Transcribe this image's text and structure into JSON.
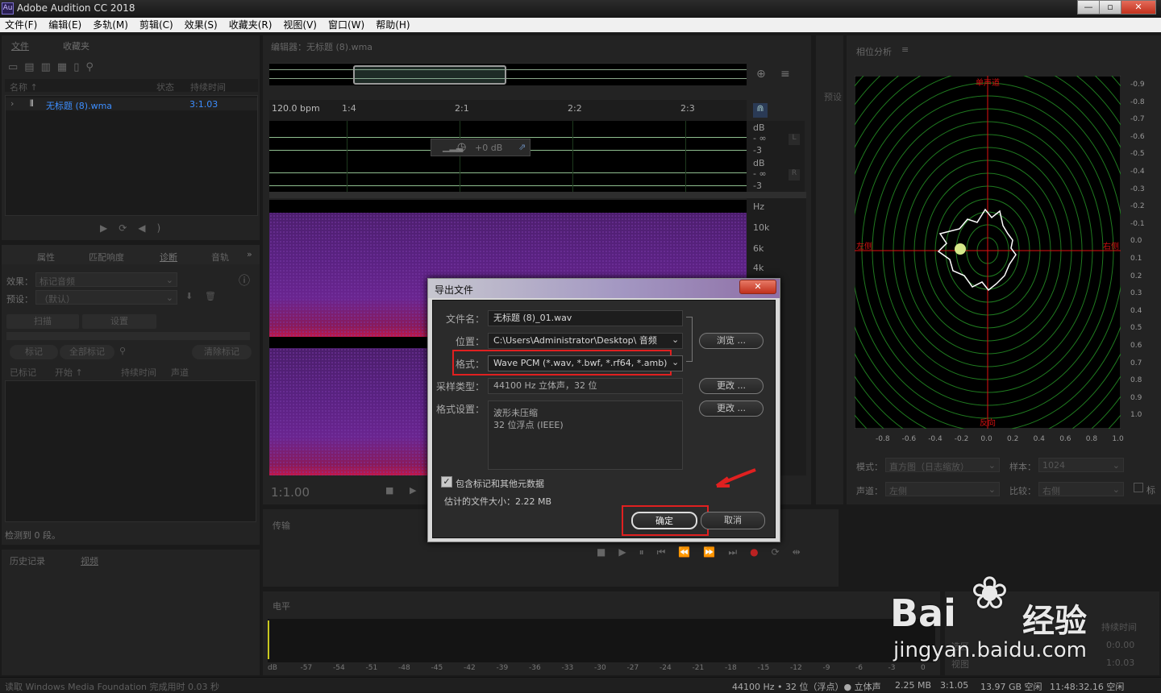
{
  "app": {
    "title": "Adobe Audition CC 2018",
    "logo": "Au",
    "win_buttons": [
      "—",
      "▫",
      "✕"
    ]
  },
  "menu": [
    "文件(F)",
    "编辑(E)",
    "多轨(M)",
    "剪辑(C)",
    "效果(S)",
    "收藏夹(R)",
    "视图(V)",
    "窗口(W)",
    "帮助(H)"
  ],
  "files_panel": {
    "tabs": [
      "文件",
      "收藏夹"
    ],
    "cols": [
      "名称 ↑",
      "状态",
      "持续时间"
    ],
    "file": {
      "name": "无标题 (8).wma",
      "duration": "3:1.03"
    }
  },
  "props_panel": {
    "tabs": [
      "属性",
      "匹配响度",
      "诊断",
      "音轨"
    ],
    "effect_label": "效果：",
    "effect_value": "标记音频",
    "preset_label": "预设：",
    "preset_value": "（默认）",
    "scan": "扫描",
    "settings": "设置",
    "mark": "标记",
    "mark_all": "全部标记",
    "clear_marks": "清除标记",
    "cols": [
      "已标记",
      "开始 ↑",
      "持续时间",
      "声道"
    ],
    "detected": "检测到 0 段。"
  },
  "bottom_left": {
    "tabs": [
      "历史记录",
      "视频"
    ]
  },
  "status_left": "读取 Windows Media Foundation 完成用时 0.03 秒",
  "editor": {
    "title": "编辑器：无标题 (8).wma",
    "bpm": "120.0 bpm",
    "ruler": [
      "1:4",
      "2:1",
      "2:2",
      "2:3"
    ],
    "db_labels": [
      "dB",
      "- ∞",
      "-3",
      "dB",
      "- ∞",
      "-3"
    ],
    "ch_labels": [
      "L",
      "R"
    ],
    "hz_labels": [
      "Hz",
      "10k",
      "6k",
      "4k"
    ],
    "volume": "+0 dB",
    "time": "1:1.00"
  },
  "presets_tab": "预设",
  "transport": {
    "title": "传输"
  },
  "levels": {
    "title": "电平",
    "ticks": [
      "dB",
      "-57",
      "-54",
      "-51",
      "-48",
      "-45",
      "-42",
      "-39",
      "-36",
      "-33",
      "-30",
      "-27",
      "-24",
      "-21",
      "-18",
      "-15",
      "-12",
      "-9",
      "-6",
      "-3",
      "0"
    ]
  },
  "phase": {
    "title": "相位分析",
    "top": "单声道",
    "left": "左侧",
    "right": "右侧",
    "bottom": "反向",
    "x_ticks": [
      "-0.8",
      "-0.6",
      "-0.4",
      "-0.2",
      "0.0",
      "0.2",
      "0.4",
      "0.6",
      "0.8",
      "1.0"
    ],
    "y_ticks": [
      "-0.9",
      "-0.8",
      "-0.7",
      "-0.6",
      "-0.5",
      "-0.4",
      "-0.3",
      "-0.2",
      "-0.1",
      "0.0",
      "0.1",
      "0.2",
      "0.3",
      "0.4",
      "0.5",
      "0.6",
      "0.7",
      "0.8",
      "0.9",
      "1.0"
    ],
    "mode_label": "模式：",
    "mode_value": "直方图（日志缩放）",
    "sample_label": "样本：",
    "sample_value": "1024",
    "channel_label": "声道：",
    "channel_value": "左侧",
    "compare_label": "比较：",
    "compare_value": "右侧",
    "extra": "标"
  },
  "sel_panel": {
    "label": "持续时间",
    "v1": "0:0.00",
    "v2": "1:0.03",
    "row1": "选区",
    "row2": "视图"
  },
  "status_right": [
    "44100 Hz • 32 位（浮点）● 立体声",
    "2.25 MB",
    "3:1.05",
    "13.97 GB 空闲",
    "11:48:32.16 空闲"
  ],
  "dialog": {
    "title": "导出文件",
    "filename_label": "文件名：",
    "filename": "无标题 (8)_01.wav",
    "location_label": "位置：",
    "location": "C:\\Users\\Administrator\\Desktop\\ 音频",
    "browse": "浏览 ...",
    "format_label": "格式：",
    "format": "Wave PCM (*.wav, *.bwf, *.rf64, *.amb)",
    "sample_label": "采样类型：",
    "sample": "44100 Hz 立体声，32 位",
    "change": "更改 ...",
    "fmtset_label": "格式设置：",
    "fmtset_line1": "波形未压缩",
    "fmtset_line2": "32 位浮点 (IEEE)",
    "include_meta": "包含标记和其他元数据",
    "est_size": "估计的文件大小：2.22 MB",
    "ok": "确定",
    "cancel": "取消"
  },
  "watermark": {
    "brand": "Bai",
    "brand2": "经验",
    "url": "jingyan.baidu.com"
  },
  "colors": {
    "highlight": "#e02020",
    "accent_blue": "#3d8eff",
    "phase_grid": "#1f7a1f",
    "phase_axis": "#e01010"
  }
}
